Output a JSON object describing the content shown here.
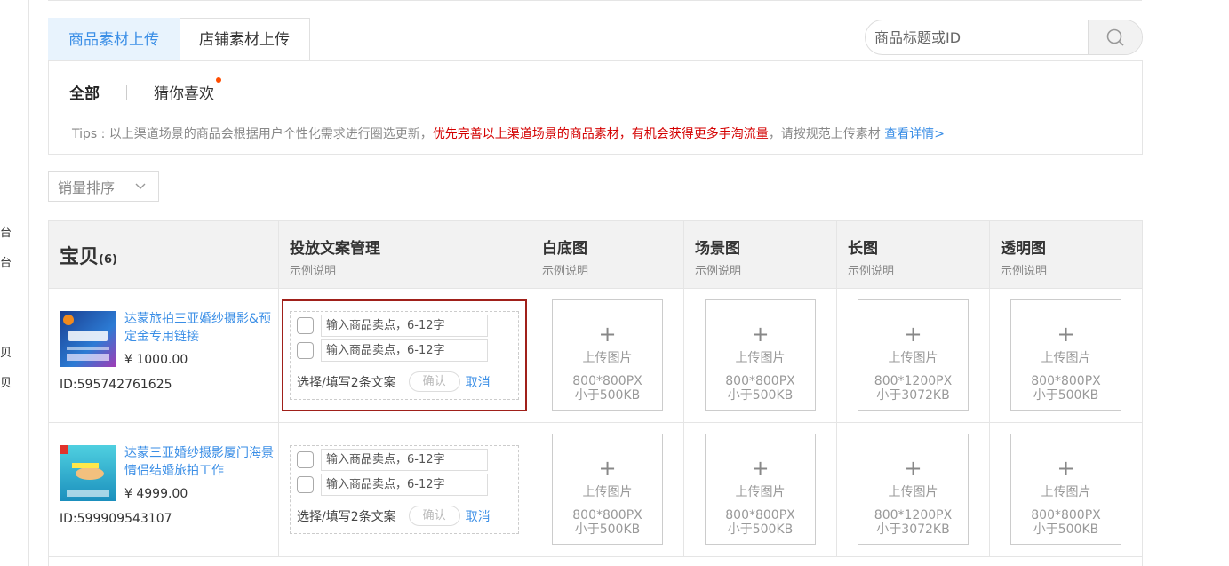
{
  "left_rail": [
    "台",
    "台",
    "贝",
    "贝"
  ],
  "tabs": [
    {
      "label": "商品素材上传",
      "active": true
    },
    {
      "label": "店铺素材上传",
      "active": false
    }
  ],
  "search": {
    "placeholder": "商品标题或ID"
  },
  "subtabs": {
    "all": "全部",
    "guess": "猜你喜欢"
  },
  "tips": {
    "prefix": "Tips : 以上渠道场景的商品会根据用户个性化需求进行圈选更新，",
    "highlight": "优先完善以上渠道场景的商品素材，有机会获得更多手淘流量",
    "suffix": "，请按规范上传素材 ",
    "link": "查看详情>"
  },
  "sort": {
    "label": "销量排序"
  },
  "table": {
    "columns": {
      "main": {
        "title": "宝贝",
        "count": "(6)"
      },
      "copy": {
        "title": "投放文案管理",
        "sub": "示例说明"
      },
      "white": {
        "title": "白底图",
        "sub": "示例说明"
      },
      "scene": {
        "title": "场景图",
        "sub": "示例说明"
      },
      "long": {
        "title": "长图",
        "sub": "示例说明"
      },
      "trans": {
        "title": "透明图",
        "sub": "示例说明"
      }
    },
    "copy_placeholder": "输入商品卖点，6-12字",
    "copy_hint": "选择/填写2条文案",
    "confirm": "确认",
    "cancel": "取消",
    "upload_label": "上传图片",
    "upload_specs": {
      "white": [
        "800*800PX",
        "小于500KB"
      ],
      "scene": [
        "800*800PX",
        "小于500KB"
      ],
      "long": [
        "800*1200PX",
        "小于3072KB"
      ],
      "trans": [
        "800*800PX",
        "小于500KB"
      ]
    },
    "rows": [
      {
        "title": "达蒙旅拍三亚婚纱摄影&预定金专用链接",
        "price": "¥ 1000.00",
        "id": "ID:595742761625"
      },
      {
        "title": "达蒙三亚婚纱摄影厦门海景情侣结婚旅拍工作",
        "price": "¥ 4999.00",
        "id": "ID:599909543107"
      }
    ]
  },
  "colors": {
    "accent": "#3a8ee6",
    "highlight_border": "#a0201a",
    "tip_red": "#d40000"
  }
}
